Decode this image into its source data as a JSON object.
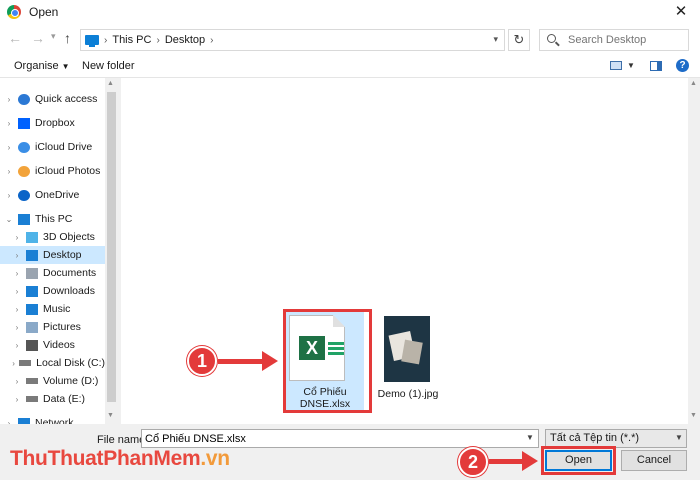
{
  "window": {
    "title": "Open",
    "close_glyph": "✕"
  },
  "nav": {
    "back_glyph": "←",
    "forward_glyph": "→",
    "up_glyph": "↑",
    "breadcrumb": [
      "This PC",
      "Desktop"
    ],
    "refresh_glyph": "↻",
    "search_placeholder": "Search Desktop"
  },
  "toolbar": {
    "organise_label": "Organise",
    "new_folder_label": "New folder",
    "help_glyph": "?"
  },
  "sidebar": {
    "items": [
      {
        "label": "Quick access",
        "icon": "star-icon",
        "color": "#2b78d4",
        "level": 0
      },
      {
        "label": "Dropbox",
        "icon": "dropbox-icon",
        "color": "#0061fe",
        "level": 0
      },
      {
        "label": "iCloud Drive",
        "icon": "icloud-icon",
        "color": "#3a8ee6",
        "level": 0
      },
      {
        "label": "iCloud Photos",
        "icon": "photos-icon",
        "color": "#f2a33a",
        "level": 0
      },
      {
        "label": "OneDrive",
        "icon": "onedrive-icon",
        "color": "#0a64c8",
        "level": 0
      },
      {
        "label": "This PC",
        "icon": "pc-icon",
        "color": "#1a7fd4",
        "level": 0
      },
      {
        "label": "3D Objects",
        "icon": "cube-icon",
        "color": "#4fb3e8",
        "level": 1
      },
      {
        "label": "Desktop",
        "icon": "desktop-icon",
        "color": "#1a7fd4",
        "level": 1
      },
      {
        "label": "Documents",
        "icon": "documents-icon",
        "color": "#9aa4b0",
        "level": 1
      },
      {
        "label": "Downloads",
        "icon": "download-icon",
        "color": "#1a7fd4",
        "level": 1
      },
      {
        "label": "Music",
        "icon": "music-icon",
        "color": "#1a7fd4",
        "level": 1
      },
      {
        "label": "Pictures",
        "icon": "pictures-icon",
        "color": "#8aa9c8",
        "level": 1
      },
      {
        "label": "Videos",
        "icon": "video-icon",
        "color": "#555555",
        "level": 1
      },
      {
        "label": "Local Disk (C:)",
        "icon": "disk-icon",
        "color": "#7a7a7a",
        "level": 1
      },
      {
        "label": "Volume (D:)",
        "icon": "disk-icon",
        "color": "#7a7a7a",
        "level": 1
      },
      {
        "label": "Data (E:)",
        "icon": "disk-icon",
        "color": "#7a7a7a",
        "level": 1
      },
      {
        "label": "Network",
        "icon": "network-icon",
        "color": "#1a7fd4",
        "level": 0
      }
    ],
    "selected": "Desktop"
  },
  "files": [
    {
      "name_line1": "Cổ Phiếu",
      "name_line2": "DNSE.xlsx",
      "type": "xlsx",
      "selected": true
    },
    {
      "name_line1": "Demo (1).jpg",
      "name_line2": "",
      "type": "jpg",
      "selected": false
    }
  ],
  "annotations": {
    "step1": "1",
    "step2": "2",
    "accent": "#e33a3a"
  },
  "footer": {
    "file_name_label": "File name:",
    "file_name_value": "Cổ Phiếu DNSE.xlsx",
    "file_type_value": "Tất cả Tệp tin (*.*)",
    "open_label": "Open",
    "cancel_label": "Cancel"
  },
  "watermark": {
    "part1": "ThuThuat",
    "part2": "PhanMem",
    "part3": ".vn"
  }
}
